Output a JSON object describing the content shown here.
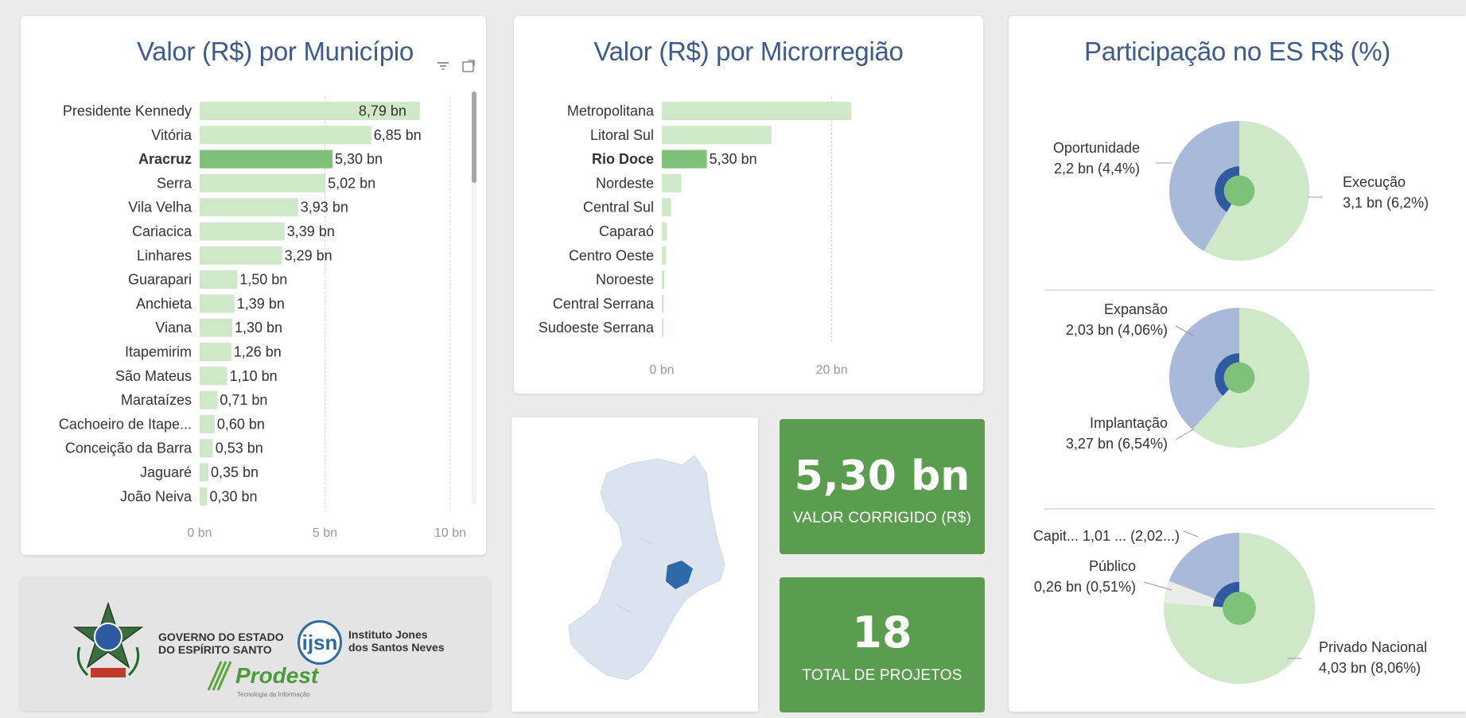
{
  "municipio_card": {
    "title": "Valor (R$) por Município",
    "filter_icon": "filter-icon",
    "focus_icon": "focus-mode-icon",
    "chart_data": {
      "type": "bar",
      "orientation": "horizontal",
      "categories": [
        "Presidente Kennedy",
        "Vitória",
        "Aracruz",
        "Serra",
        "Vila Velha",
        "Cariacica",
        "Linhares",
        "Guarapari",
        "Anchieta",
        "Viana",
        "Itapemirim",
        "São Mateus",
        "Marataízes",
        "Cachoeiro de Itape...",
        "Conceição da Barra",
        "Jaguaré",
        "João Neiva"
      ],
      "values": [
        8.79,
        6.85,
        5.3,
        5.02,
        3.93,
        3.39,
        3.29,
        1.5,
        1.39,
        1.3,
        1.26,
        1.1,
        0.71,
        0.6,
        0.53,
        0.35,
        0.3
      ],
      "data_labels": [
        "8,79 bn",
        "6,85 bn",
        "5,30 bn",
        "5,02 bn",
        "3,93 bn",
        "3,39 bn",
        "3,29 bn",
        "1,50 bn",
        "1,39 bn",
        "1,30 bn",
        "1,26 bn",
        "1,10 bn",
        "0,71 bn",
        "0,60 bn",
        "0,53 bn",
        "0,35 bn",
        "0,30 bn"
      ],
      "highlighted": "Aracruz",
      "xlim": [
        0,
        10
      ],
      "x_ticks": [
        0,
        5,
        10
      ],
      "x_tick_labels": [
        "0 bn",
        "5 bn",
        "10 bn"
      ],
      "colors": {
        "bar": "#cfe8c8",
        "highlight": "#7ec27a"
      }
    }
  },
  "micro_card": {
    "title": "Valor (R$) por Microrregião",
    "chart_data": {
      "type": "bar",
      "orientation": "horizontal",
      "categories": [
        "Metropolitana",
        "Litoral Sul",
        "Rio Doce",
        "Nordeste",
        "Central Sul",
        "Caparaó",
        "Centro Oeste",
        "Noroeste",
        "Central Serrana",
        "Sudoeste Serrana"
      ],
      "values": [
        22.3,
        12.9,
        5.3,
        2.3,
        1.1,
        0.6,
        0.5,
        0.3,
        0.2,
        0.15
      ],
      "data_labels": [
        "",
        "",
        "5,30 bn",
        "",
        "",
        "",
        "",
        "",
        "",
        ""
      ],
      "highlighted": "Rio Doce",
      "xlim": [
        0,
        25
      ],
      "x_ticks": [
        0,
        20
      ],
      "x_tick_labels": [
        "0 bn",
        "20 bn"
      ],
      "colors": {
        "bar": "#cfe8c8",
        "highlight": "#7ec27a"
      }
    }
  },
  "map_card": {
    "colors": {
      "land": "#dbe3ee",
      "highlight": "#2e6aa7"
    }
  },
  "kpi_valor": {
    "value": "5,30 bn",
    "label": "VALOR CORRIGIDO (R$)"
  },
  "kpi_projetos": {
    "value": "18",
    "label": "TOTAL DE PROJETOS"
  },
  "logos": {
    "gov_line1": "GOVERNO DO ESTADO",
    "gov_line2": "DO ESPÍRITO SANTO",
    "ijsn_abbr": "ijsn",
    "ijsn_line1": "Instituto Jones",
    "ijsn_line2": "dos Santos Neves",
    "prodest_name": "Prodest",
    "prodest_tagline": "Tecnologia da Informação"
  },
  "participacao_card": {
    "title": "Participação no ES R$ (%)",
    "chart_data": [
      {
        "type": "pie",
        "slices": [
          {
            "label": "Execução",
            "value_label": "3,1 bn (6,2%)",
            "value": 6.2,
            "color": "#cfe8c8"
          },
          {
            "label": "Oportunidade",
            "value_label": "2,2 bn (4,4%)",
            "value": 4.4,
            "color": "#a9b9d9"
          }
        ],
        "inner_highlight": {
          "color": "#7ec27a",
          "dark": "#2f5aa0"
        }
      },
      {
        "type": "pie",
        "slices": [
          {
            "label": "Implantação",
            "value_label": "3,27 bn (6,54%)",
            "value": 6.54,
            "color": "#cfe8c8"
          },
          {
            "label": "Expansão",
            "value_label": "2,03 bn (4,06%)",
            "value": 4.06,
            "color": "#a9b9d9"
          }
        ],
        "inner_highlight": {
          "color": "#7ec27a",
          "dark": "#2f5aa0"
        }
      },
      {
        "type": "pie",
        "slices": [
          {
            "label": "Privado Nacional",
            "value_label": "4,03 bn (8,06%)",
            "value": 8.06,
            "color": "#cfe8c8"
          },
          {
            "label": "Público",
            "value_label": "0,26 bn (0,51%)",
            "value": 0.51,
            "color": "#e9efe6"
          },
          {
            "label": "Capit...",
            "value_label": "1,01 ... (2,02...)",
            "value": 2.02,
            "color": "#a9b9d9"
          }
        ],
        "inner_highlight": {
          "color": "#7ec27a",
          "dark": "#2f5aa0"
        }
      }
    ]
  }
}
